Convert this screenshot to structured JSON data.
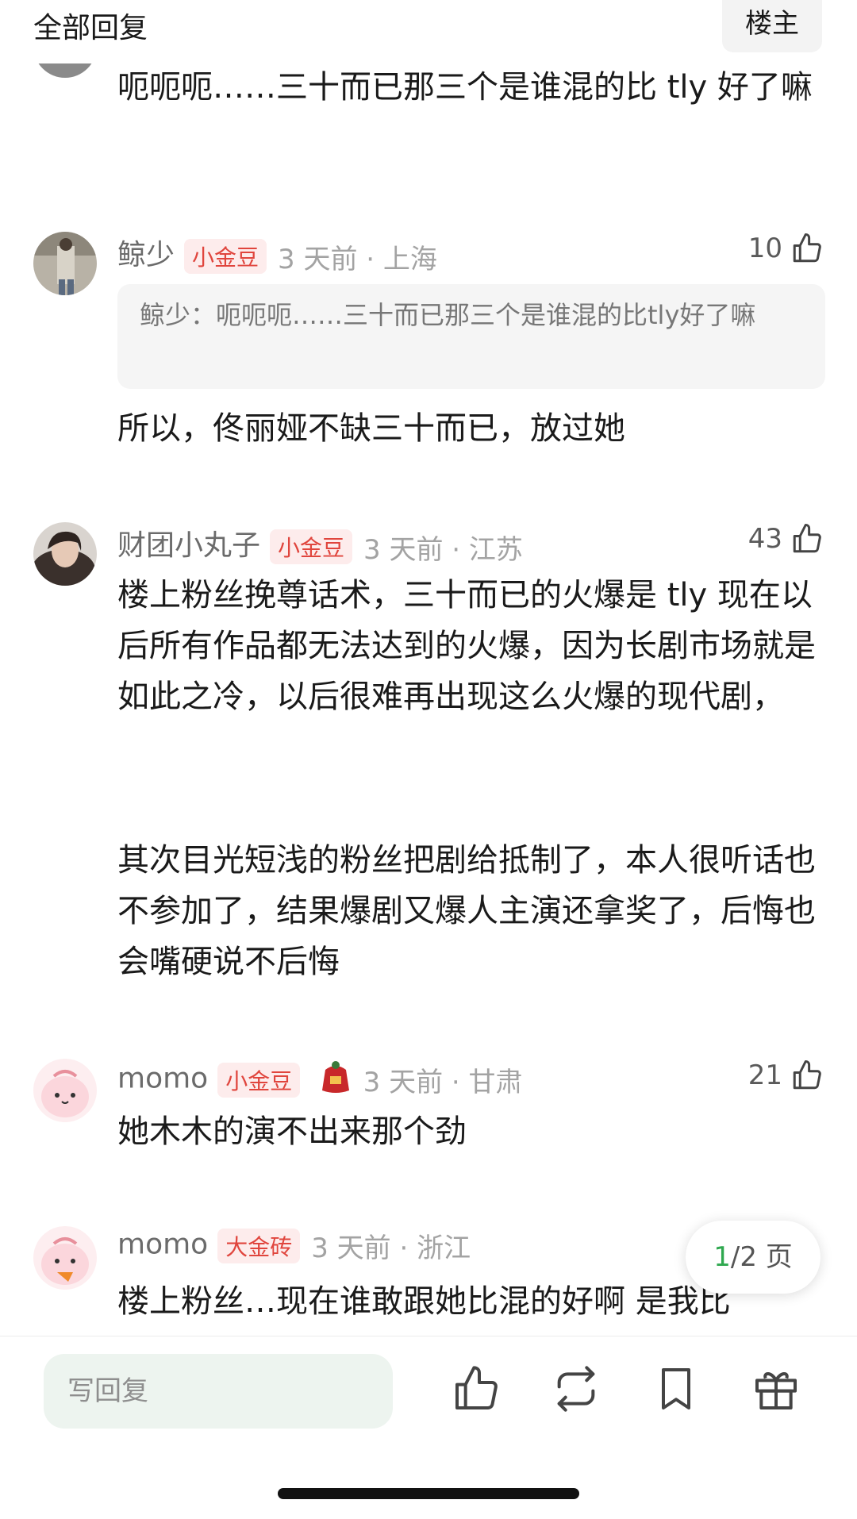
{
  "header": {
    "title": "全部回复",
    "op_label": "楼主"
  },
  "comments": [
    {
      "text": "呃呃呃……三十而已那三个是谁混的比 tly 好了嘛"
    },
    {
      "username": "鲸少",
      "badge": "小金豆",
      "meta": "3 天前 · 上海",
      "likes": "10",
      "quote": "鲸少：呃呃呃……三十而已那三个是谁混的比tly好了嘛",
      "text": "所以，佟丽娅不缺三十而已，放过她"
    },
    {
      "username": "财团小丸子",
      "badge": "小金豆",
      "meta": "3 天前 · 江苏",
      "likes": "43",
      "text": "楼上粉丝挽尊话术，三十而已的火爆是 tly 现在以后所有作品都无法达到的火爆，因为长剧市场就是如此之冷，以后很难再出现这么火爆的现代剧，",
      "text2": "其次目光短浅的粉丝把剧给抵制了，本人很听话也不参加了，结果爆剧又爆人主演还拿奖了，后悔也会嘴硬说不后悔"
    },
    {
      "username": "momo",
      "badge": "小金豆",
      "meta": "3 天前 · 甘肃",
      "likes": "21",
      "text": "她木木的演不出来那个劲"
    },
    {
      "username": "momo",
      "badge": "大金砖",
      "meta": "3 天前 · 浙江",
      "text": "楼上粉丝…现在谁敢跟她比混的好啊 是我比"
    }
  ],
  "pager": {
    "current": "1",
    "total": "/2 页"
  },
  "footer": {
    "reply_placeholder": "写回复",
    "icons": [
      "like-icon",
      "repost-icon",
      "bookmark-icon",
      "gift-icon"
    ]
  },
  "colors": {
    "accent_green": "#2fa84f",
    "badge_red": "#e0453d",
    "badge_bg": "#fdecec"
  }
}
